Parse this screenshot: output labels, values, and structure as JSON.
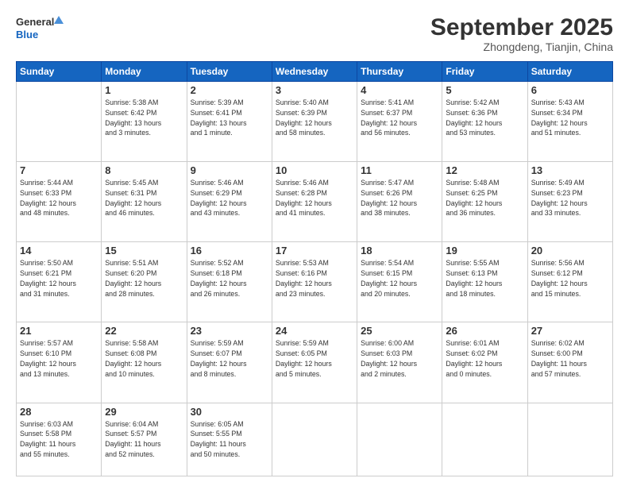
{
  "logo": {
    "line1": "General",
    "line2": "Blue"
  },
  "title": "September 2025",
  "location": "Zhongdeng, Tianjin, China",
  "weekdays": [
    "Sunday",
    "Monday",
    "Tuesday",
    "Wednesday",
    "Thursday",
    "Friday",
    "Saturday"
  ],
  "weeks": [
    [
      {
        "day": "",
        "sunrise": "",
        "sunset": "",
        "daylight": ""
      },
      {
        "day": "1",
        "sunrise": "Sunrise: 5:38 AM",
        "sunset": "Sunset: 6:42 PM",
        "daylight": "Daylight: 13 hours and 3 minutes."
      },
      {
        "day": "2",
        "sunrise": "Sunrise: 5:39 AM",
        "sunset": "Sunset: 6:41 PM",
        "daylight": "Daylight: 13 hours and 1 minute."
      },
      {
        "day": "3",
        "sunrise": "Sunrise: 5:40 AM",
        "sunset": "Sunset: 6:39 PM",
        "daylight": "Daylight: 12 hours and 58 minutes."
      },
      {
        "day": "4",
        "sunrise": "Sunrise: 5:41 AM",
        "sunset": "Sunset: 6:37 PM",
        "daylight": "Daylight: 12 hours and 56 minutes."
      },
      {
        "day": "5",
        "sunrise": "Sunrise: 5:42 AM",
        "sunset": "Sunset: 6:36 PM",
        "daylight": "Daylight: 12 hours and 53 minutes."
      },
      {
        "day": "6",
        "sunrise": "Sunrise: 5:43 AM",
        "sunset": "Sunset: 6:34 PM",
        "daylight": "Daylight: 12 hours and 51 minutes."
      }
    ],
    [
      {
        "day": "7",
        "sunrise": "Sunrise: 5:44 AM",
        "sunset": "Sunset: 6:33 PM",
        "daylight": "Daylight: 12 hours and 48 minutes."
      },
      {
        "day": "8",
        "sunrise": "Sunrise: 5:45 AM",
        "sunset": "Sunset: 6:31 PM",
        "daylight": "Daylight: 12 hours and 46 minutes."
      },
      {
        "day": "9",
        "sunrise": "Sunrise: 5:46 AM",
        "sunset": "Sunset: 6:29 PM",
        "daylight": "Daylight: 12 hours and 43 minutes."
      },
      {
        "day": "10",
        "sunrise": "Sunrise: 5:46 AM",
        "sunset": "Sunset: 6:28 PM",
        "daylight": "Daylight: 12 hours and 41 minutes."
      },
      {
        "day": "11",
        "sunrise": "Sunrise: 5:47 AM",
        "sunset": "Sunset: 6:26 PM",
        "daylight": "Daylight: 12 hours and 38 minutes."
      },
      {
        "day": "12",
        "sunrise": "Sunrise: 5:48 AM",
        "sunset": "Sunset: 6:25 PM",
        "daylight": "Daylight: 12 hours and 36 minutes."
      },
      {
        "day": "13",
        "sunrise": "Sunrise: 5:49 AM",
        "sunset": "Sunset: 6:23 PM",
        "daylight": "Daylight: 12 hours and 33 minutes."
      }
    ],
    [
      {
        "day": "14",
        "sunrise": "Sunrise: 5:50 AM",
        "sunset": "Sunset: 6:21 PM",
        "daylight": "Daylight: 12 hours and 31 minutes."
      },
      {
        "day": "15",
        "sunrise": "Sunrise: 5:51 AM",
        "sunset": "Sunset: 6:20 PM",
        "daylight": "Daylight: 12 hours and 28 minutes."
      },
      {
        "day": "16",
        "sunrise": "Sunrise: 5:52 AM",
        "sunset": "Sunset: 6:18 PM",
        "daylight": "Daylight: 12 hours and 26 minutes."
      },
      {
        "day": "17",
        "sunrise": "Sunrise: 5:53 AM",
        "sunset": "Sunset: 6:16 PM",
        "daylight": "Daylight: 12 hours and 23 minutes."
      },
      {
        "day": "18",
        "sunrise": "Sunrise: 5:54 AM",
        "sunset": "Sunset: 6:15 PM",
        "daylight": "Daylight: 12 hours and 20 minutes."
      },
      {
        "day": "19",
        "sunrise": "Sunrise: 5:55 AM",
        "sunset": "Sunset: 6:13 PM",
        "daylight": "Daylight: 12 hours and 18 minutes."
      },
      {
        "day": "20",
        "sunrise": "Sunrise: 5:56 AM",
        "sunset": "Sunset: 6:12 PM",
        "daylight": "Daylight: 12 hours and 15 minutes."
      }
    ],
    [
      {
        "day": "21",
        "sunrise": "Sunrise: 5:57 AM",
        "sunset": "Sunset: 6:10 PM",
        "daylight": "Daylight: 12 hours and 13 minutes."
      },
      {
        "day": "22",
        "sunrise": "Sunrise: 5:58 AM",
        "sunset": "Sunset: 6:08 PM",
        "daylight": "Daylight: 12 hours and 10 minutes."
      },
      {
        "day": "23",
        "sunrise": "Sunrise: 5:59 AM",
        "sunset": "Sunset: 6:07 PM",
        "daylight": "Daylight: 12 hours and 8 minutes."
      },
      {
        "day": "24",
        "sunrise": "Sunrise: 5:59 AM",
        "sunset": "Sunset: 6:05 PM",
        "daylight": "Daylight: 12 hours and 5 minutes."
      },
      {
        "day": "25",
        "sunrise": "Sunrise: 6:00 AM",
        "sunset": "Sunset: 6:03 PM",
        "daylight": "Daylight: 12 hours and 2 minutes."
      },
      {
        "day": "26",
        "sunrise": "Sunrise: 6:01 AM",
        "sunset": "Sunset: 6:02 PM",
        "daylight": "Daylight: 12 hours and 0 minutes."
      },
      {
        "day": "27",
        "sunrise": "Sunrise: 6:02 AM",
        "sunset": "Sunset: 6:00 PM",
        "daylight": "Daylight: 11 hours and 57 minutes."
      }
    ],
    [
      {
        "day": "28",
        "sunrise": "Sunrise: 6:03 AM",
        "sunset": "Sunset: 5:58 PM",
        "daylight": "Daylight: 11 hours and 55 minutes."
      },
      {
        "day": "29",
        "sunrise": "Sunrise: 6:04 AM",
        "sunset": "Sunset: 5:57 PM",
        "daylight": "Daylight: 11 hours and 52 minutes."
      },
      {
        "day": "30",
        "sunrise": "Sunrise: 6:05 AM",
        "sunset": "Sunset: 5:55 PM",
        "daylight": "Daylight: 11 hours and 50 minutes."
      },
      {
        "day": "",
        "sunrise": "",
        "sunset": "",
        "daylight": ""
      },
      {
        "day": "",
        "sunrise": "",
        "sunset": "",
        "daylight": ""
      },
      {
        "day": "",
        "sunrise": "",
        "sunset": "",
        "daylight": ""
      },
      {
        "day": "",
        "sunrise": "",
        "sunset": "",
        "daylight": ""
      }
    ]
  ]
}
